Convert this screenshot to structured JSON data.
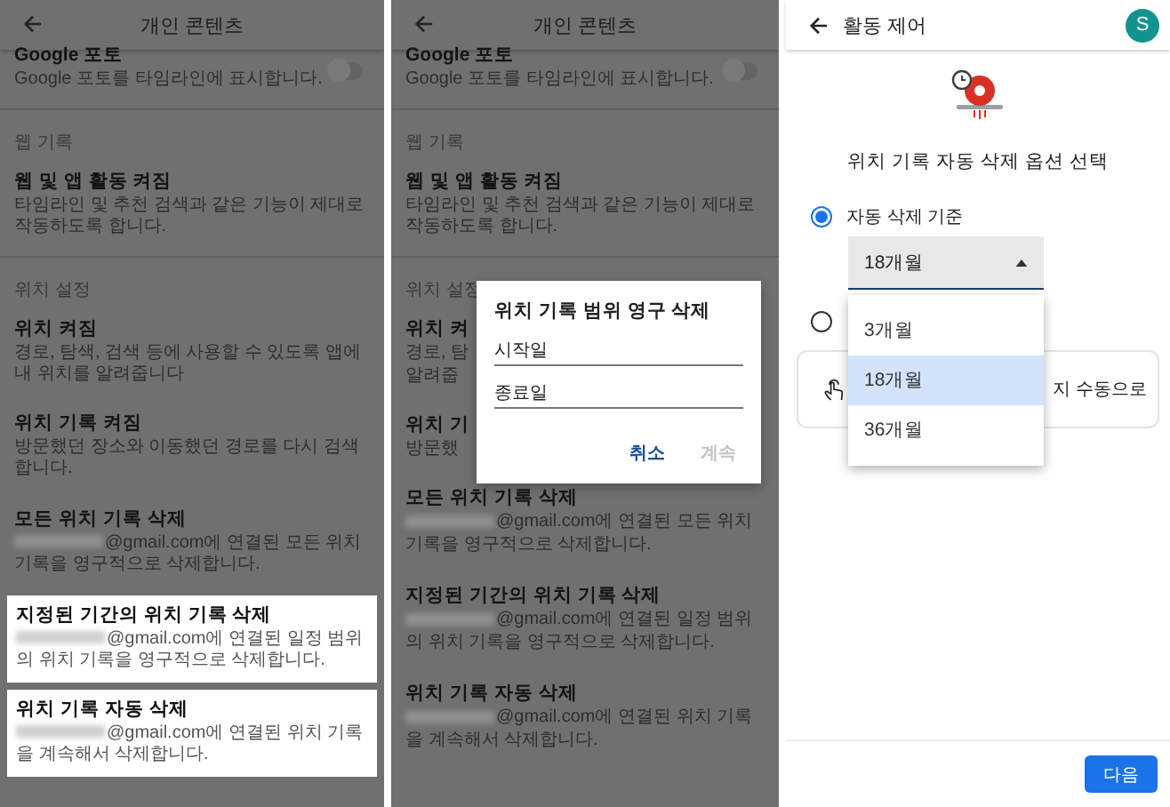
{
  "settings_screen": {
    "header": {
      "title": "개인 콘텐츠"
    },
    "items": [
      {
        "kind": "toggle",
        "title": "Google 포토",
        "desc": "Google 포토를 타임라인에 표시합니다.",
        "on": false
      },
      {
        "kind": "section",
        "label": "웹 기록"
      },
      {
        "kind": "item",
        "title": "웹 및 앱 활동 켜짐",
        "desc": "타임라인 및 추천 검색과 같은 기능이 제대로 작동하도록 합니다."
      },
      {
        "kind": "section",
        "label": "위치 설정"
      },
      {
        "kind": "item",
        "title": "위치 켜짐",
        "desc": "경로, 탐색, 검색 등에 사용할 수 있도록 앱에 내 위치를 알려줍니다"
      },
      {
        "kind": "item",
        "title": "위치 기록 켜짐",
        "desc": "방문했던 장소와 이동했던 경로를 다시 검색합니다."
      },
      {
        "kind": "account_item",
        "title": "모든 위치 기록 삭제",
        "desc": "@gmail.com에 연결된 모든 위치 기록을 영구적으로 삭제합니다.",
        "highlighted": false
      },
      {
        "kind": "account_item",
        "title": "지정된 기간의 위치 기록 삭제",
        "desc": "@gmail.com에 연결된 일정 범위의 위치 기록을 영구적으로 삭제합니다.",
        "highlighted": true
      },
      {
        "kind": "account_item",
        "title": "위치 기록 자동 삭제",
        "desc": "@gmail.com에 연결된 위치 기록을 계속해서 삭제합니다.",
        "highlighted": true
      }
    ]
  },
  "dialog_screen": {
    "header": {
      "title": "개인 콘텐츠"
    },
    "items": [
      {
        "kind": "toggle",
        "title": "Google 포토",
        "desc": "Google 포토를 타임라인에 표시합니다.",
        "on": false
      },
      {
        "kind": "section",
        "label": "웹 기록"
      },
      {
        "kind": "item",
        "title": "웹 및 앱 활동 켜짐",
        "desc": "타임라인 및 추천 검색과 같은 기능이 제대로 작동하도록 합니다."
      },
      {
        "kind": "section",
        "label": "위치 설정"
      },
      {
        "kind": "clipped",
        "title": "위치 켜",
        "lines": [
          "경로, 탐",
          "알려줍"
        ]
      },
      {
        "kind": "clipped",
        "title": "위치 기",
        "lines": [
          "방문했"
        ]
      },
      {
        "kind": "account_item",
        "title": "모든 위치 기록 삭제",
        "desc": "@gmail.com에 연결된 모든 위치 기록을 영구적으로 삭제합니다.",
        "highlighted": false
      },
      {
        "kind": "account_item",
        "title": "지정된 기간의 위치 기록 삭제",
        "desc": "@gmail.com에 연결된 일정 범위의 위치 기록을 영구적으로 삭제합니다.",
        "highlighted": false
      },
      {
        "kind": "account_item",
        "title": "위치 기록 자동 삭제",
        "desc": "@gmail.com에 연결된 위치 기록을 계속해서 삭제합니다.",
        "highlighted": false
      }
    ],
    "dialog": {
      "title": "위치 기록 범위 영구 삭제",
      "fields": [
        {
          "placeholder": "시작일"
        },
        {
          "placeholder": "종료일"
        }
      ],
      "buttons": [
        {
          "label": "취소",
          "disabled": false
        },
        {
          "label": "계속",
          "disabled": true
        }
      ]
    }
  },
  "auto_delete_screen": {
    "header": {
      "title": "활동 제어",
      "avatar": "S"
    },
    "heading": "위치 기록 자동 삭제 옵션 선택",
    "options": [
      {
        "kind": "dropdown",
        "label": "자동 삭제 기준",
        "selected": true,
        "value": "18개월",
        "menu": [
          {
            "label": "3개월",
            "selected": false
          },
          {
            "label": "18개월",
            "selected": true
          },
          {
            "label": "36개월",
            "selected": false
          }
        ]
      },
      {
        "kind": "plain",
        "selected": false
      }
    ],
    "card": {
      "text": "지 수동으로"
    },
    "next_button": "다음"
  }
}
